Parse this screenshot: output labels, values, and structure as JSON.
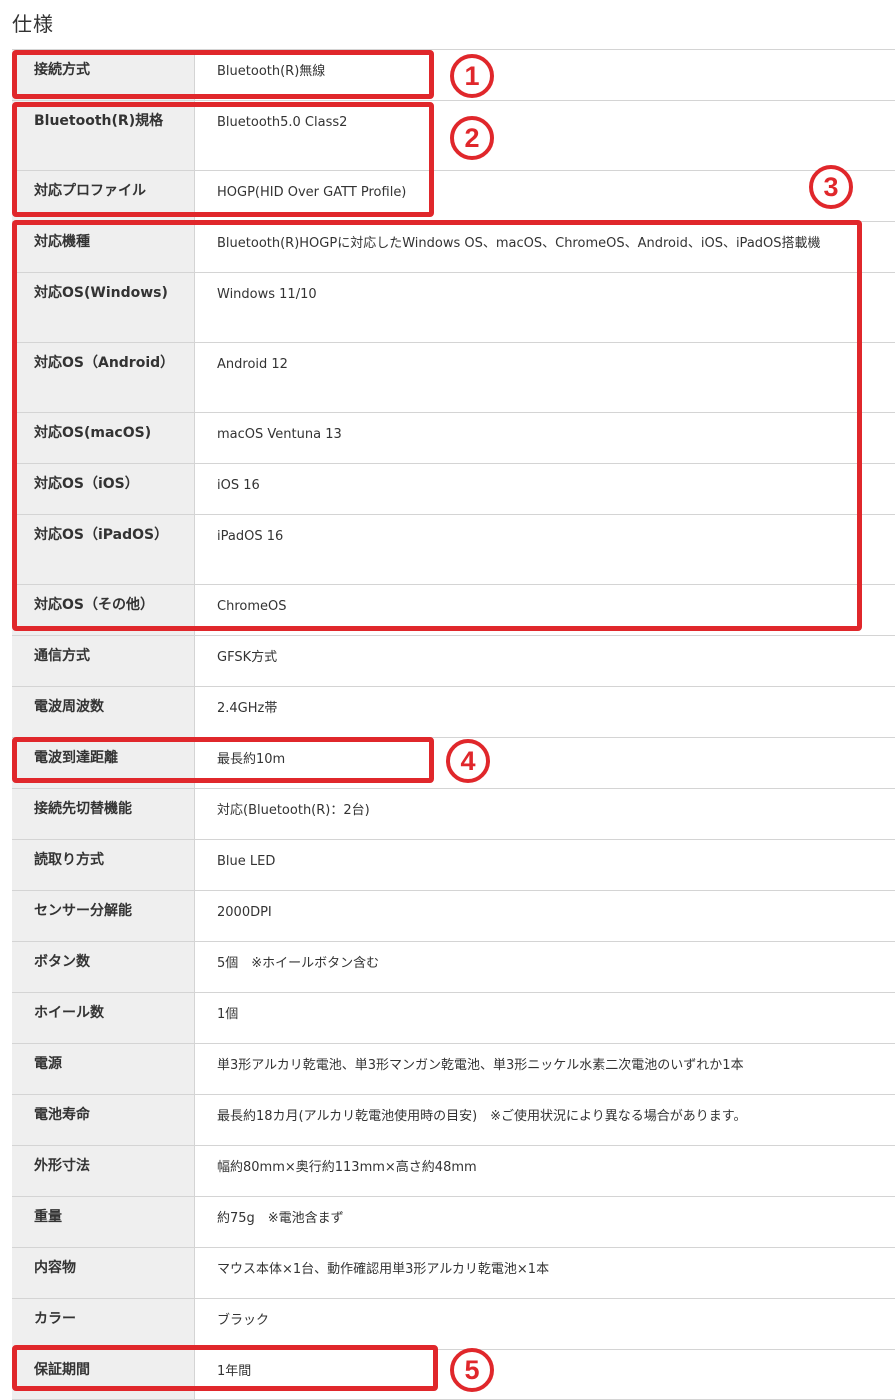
{
  "page_title": "仕様",
  "rows": [
    {
      "label": "接続方式",
      "value": "Bluetooth(R)無線",
      "h": 51
    },
    {
      "label": "Bluetooth(R)規格",
      "value": "Bluetooth5.0 Class2",
      "h": 70
    },
    {
      "label": "対応プロファイル",
      "value": "HOGP(HID Over GATT Profile)",
      "h": 51
    },
    {
      "label": "対応機種",
      "value": "Bluetooth(R)HOGPに対応したWindows OS、macOS、ChromeOS、Android、iOS、iPadOS搭載機",
      "h": 51
    },
    {
      "label": "対応OS(Windows)",
      "value": "Windows 11/10",
      "h": 70
    },
    {
      "label": "対応OS（Android）",
      "value": "Android 12",
      "h": 70
    },
    {
      "label": "対応OS(macOS)",
      "value": "macOS Ventuna 13",
      "h": 51
    },
    {
      "label": "対応OS（iOS）",
      "value": "iOS 16",
      "h": 51
    },
    {
      "label": "対応OS（iPadOS）",
      "value": "iPadOS 16",
      "h": 70
    },
    {
      "label": "対応OS（その他）",
      "value": "ChromeOS",
      "h": 51
    },
    {
      "label": "通信方式",
      "value": "GFSK方式",
      "h": 51
    },
    {
      "label": "電波周波数",
      "value": "2.4GHz帯",
      "h": 51
    },
    {
      "label": "電波到達距離",
      "value": "最長約10m",
      "h": 51
    },
    {
      "label": "接続先切替機能",
      "value": "対応(Bluetooth(R)：2台)",
      "h": 51
    },
    {
      "label": "読取り方式",
      "value": "Blue LED",
      "h": 51
    },
    {
      "label": "センサー分解能",
      "value": "2000DPI",
      "h": 51
    },
    {
      "label": "ボタン数",
      "value": "5個　※ホイールボタン含む",
      "h": 51
    },
    {
      "label": "ホイール数",
      "value": "1個",
      "h": 51
    },
    {
      "label": "電源",
      "value": "単3形アルカリ乾電池、単3形マンガン乾電池、単3形ニッケル水素二次電池のいずれか1本",
      "h": 51
    },
    {
      "label": "電池寿命",
      "value": "最長約18カ月(アルカリ乾電池使用時の目安)　※ご使用状況により異なる場合があります。",
      "h": 51
    },
    {
      "label": "外形寸法",
      "value": "幅約80mm×奥行約113mm×高さ約48mm",
      "h": 51
    },
    {
      "label": "重量",
      "value": "約75g　※電池含まず",
      "h": 51
    },
    {
      "label": "内容物",
      "value": "マウス本体×1台、動作確認用単3形アルカリ乾電池×1本",
      "h": 51
    },
    {
      "label": "カラー",
      "value": "ブラック",
      "h": 51
    },
    {
      "label": "保証期間",
      "value": "1年間",
      "h": 51
    }
  ],
  "annotations": [
    "1",
    "2",
    "3",
    "4",
    "5"
  ],
  "colors": {
    "highlight": "#e0272b",
    "label_bg": "#efefef",
    "border": "#d4d4d4"
  }
}
